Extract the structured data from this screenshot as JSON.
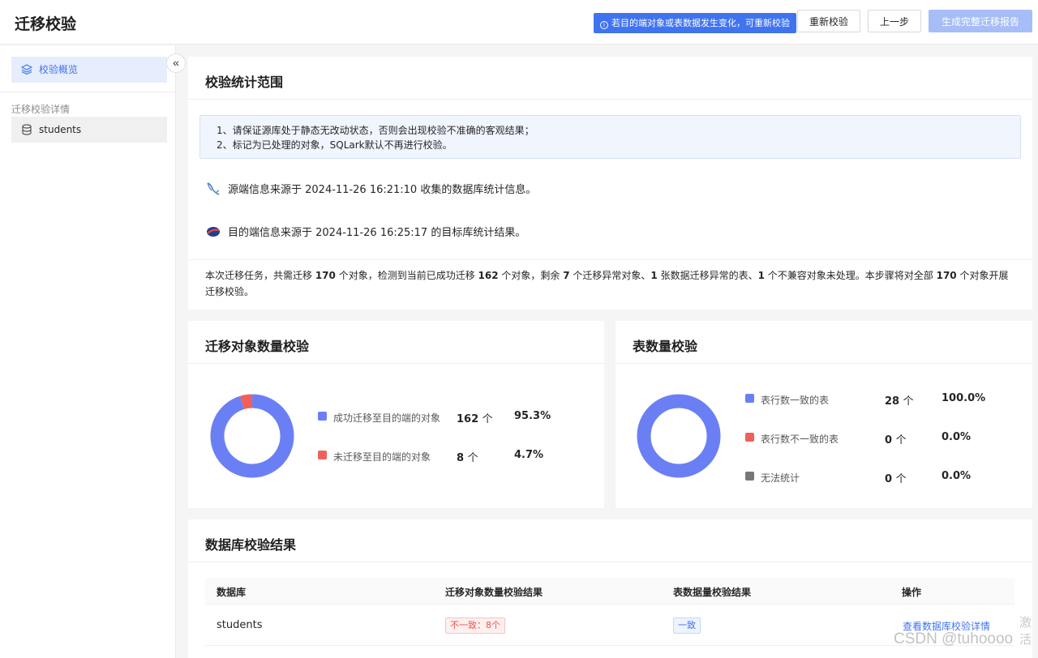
{
  "header": {
    "title": "迁移校验",
    "hint": "若目的端对象或表数据发生变化，可重新校验",
    "buttons": {
      "recheck": "重新校验",
      "prev": "上一步",
      "report": "生成完整迁移报告"
    }
  },
  "sidebar": {
    "overview": "校验概览",
    "group_title": "迁移校验详情",
    "items": [
      {
        "label": "students"
      }
    ]
  },
  "scope": {
    "title": "校验统计范围",
    "notices": [
      "1、请保证源库处于静态无改动状态，否则会出现校验不准确的客观结果；",
      "2、标记为已处理的对象，SQLark默认不再进行校验。"
    ],
    "source_info": "源端信息来源于 2024-11-26 16:21:10 收集的数据库统计信息。",
    "target_info": "目的端信息来源于 2024-11-26 16:25:17 的目标库统计结果。",
    "summary": {
      "p1": "本次迁移任务，共需迁移 ",
      "total": "170",
      "p2": " 个对象，检测到当前已成功迁移 ",
      "success": "162",
      "p3": " 个对象，剩余 ",
      "abnormal": "7",
      "p4": " 个迁移异常对象、",
      "table_abnormal": "1",
      "p5": " 张数据迁移异常的表、",
      "incompatible": "1",
      "p6": " 个不兼容对象未处理。本步骤将对全部 ",
      "all": "170",
      "p7": " 个对象开展迁移校验。"
    }
  },
  "object_check": {
    "title": "迁移对象数量校验",
    "unit": "个",
    "items": [
      {
        "label": "成功迁移至目的端的对象",
        "count": "162",
        "pct": "95.3%",
        "value": 162,
        "color": "#6b7ff5"
      },
      {
        "label": "未迁移至目的端的对象",
        "count": "8",
        "pct": "4.7%",
        "value": 8,
        "color": "#f0605a"
      }
    ]
  },
  "table_check": {
    "title": "表数量校验",
    "unit": "个",
    "items": [
      {
        "label": "表行数一致的表",
        "count": "28",
        "pct": "100.0%",
        "value": 28,
        "color": "#6b7ff5"
      },
      {
        "label": "表行数不一致的表",
        "count": "0",
        "pct": "0.0%",
        "value": 0,
        "color": "#f0605a"
      },
      {
        "label": "无法统计",
        "count": "0",
        "pct": "0.0%",
        "value": 0,
        "color": "#777777"
      }
    ]
  },
  "db_result": {
    "title": "数据库校验结果",
    "columns": [
      "数据库",
      "迁移对象数量校验结果",
      "表数据量校验结果",
      "操作"
    ],
    "rows": [
      {
        "db": "students",
        "object_result": "不一致：8个",
        "table_result": "一致",
        "action": "查看数据库校验详情"
      }
    ]
  },
  "watermark": "CSDN @tuhoooo",
  "corner_text": "激活"
}
